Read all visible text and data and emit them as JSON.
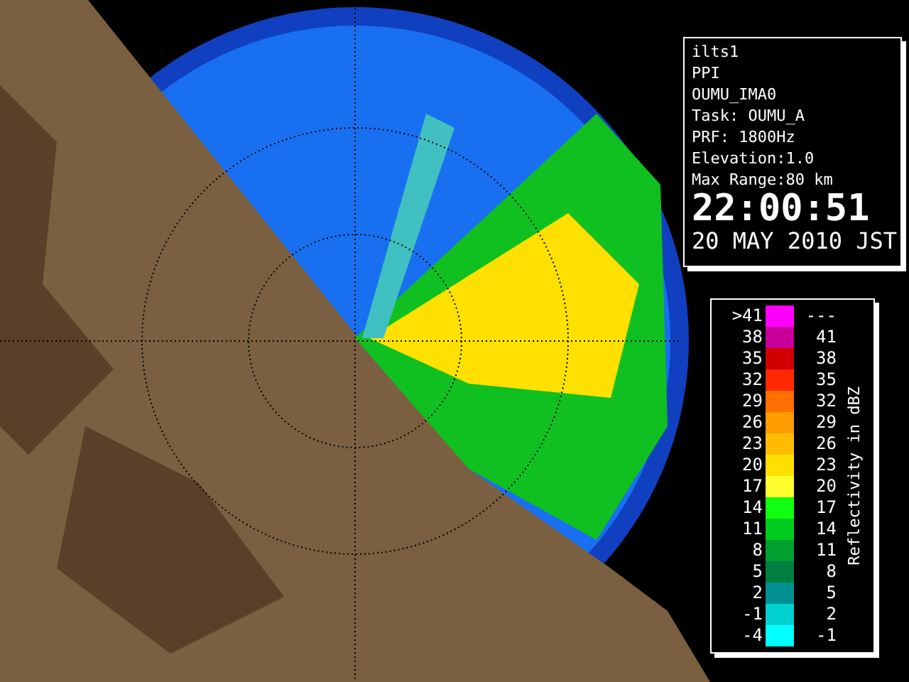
{
  "info": {
    "lines": [
      "ilts1",
      "PPI",
      "OUMU_IMA0",
      "Task: OUMU_A",
      "PRF: 1800Hz",
      "Elevation:1.0",
      "Max Range:80 km"
    ],
    "time": "22:00:51",
    "date": "20 MAY 2010 JST"
  },
  "legend": {
    "title": "Reflectivity in dBZ",
    "rows": [
      {
        "low": ">41",
        "high": "---",
        "color": "#ff00ff"
      },
      {
        "low": "38",
        "high": "41",
        "color": "#c8009a"
      },
      {
        "low": "35",
        "high": "38",
        "color": "#d00000"
      },
      {
        "low": "32",
        "high": "35",
        "color": "#ff2800"
      },
      {
        "low": "29",
        "high": "32",
        "color": "#ff7000"
      },
      {
        "low": "26",
        "high": "29",
        "color": "#ff9c00"
      },
      {
        "low": "23",
        "high": "26",
        "color": "#ffbc00"
      },
      {
        "low": "20",
        "high": "23",
        "color": "#ffe000"
      },
      {
        "low": "17",
        "high": "20",
        "color": "#ffff30"
      },
      {
        "low": "14",
        "high": "17",
        "color": "#10ff10"
      },
      {
        "low": "11",
        "high": "14",
        "color": "#00cc20"
      },
      {
        "low": "8",
        "high": "11",
        "color": "#00a030"
      },
      {
        "low": "5",
        "high": "8",
        "color": "#008040"
      },
      {
        "low": "2",
        "high": "5",
        "color": "#009090"
      },
      {
        "low": "-1",
        "high": "2",
        "color": "#00d0d0"
      },
      {
        "low": "-4",
        "high": "-1",
        "color": "#00ffff"
      }
    ]
  }
}
